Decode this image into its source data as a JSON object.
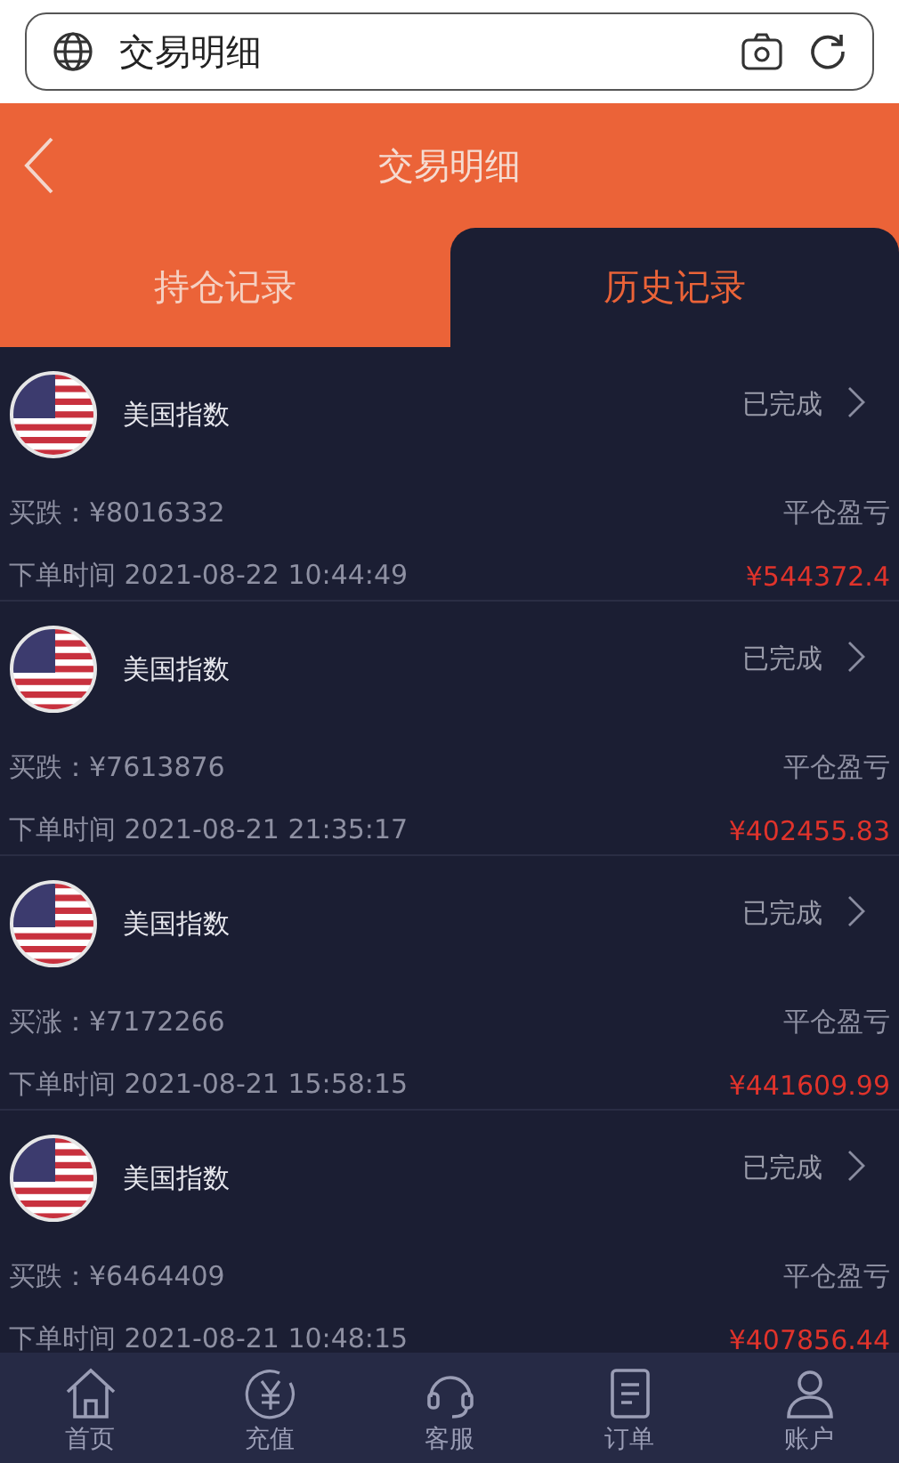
{
  "address_bar": {
    "title": "交易明细"
  },
  "header": {
    "title": "交易明细"
  },
  "tabs": [
    {
      "label": "持仓记录",
      "selected": false
    },
    {
      "label": "历史记录",
      "selected": true
    }
  ],
  "orders": [
    {
      "name": "美国指数",
      "status": "已完成",
      "trade": "买跌：¥8016332",
      "pnl_label": "平仓盈亏",
      "time": "下单时间 2021-08-22 10:44:49",
      "pnl": "¥544372.4"
    },
    {
      "name": "美国指数",
      "status": "已完成",
      "trade": "买跌：¥7613876",
      "pnl_label": "平仓盈亏",
      "time": "下单时间 2021-08-21 21:35:17",
      "pnl": "¥402455.83"
    },
    {
      "name": "美国指数",
      "status": "已完成",
      "trade": "买涨：¥7172266",
      "pnl_label": "平仓盈亏",
      "time": "下单时间 2021-08-21 15:58:15",
      "pnl": "¥441609.99"
    },
    {
      "name": "美国指数",
      "status": "已完成",
      "trade": "买跌：¥6464409",
      "pnl_label": "平仓盈亏",
      "time": "下单时间 2021-08-21 10:48:15",
      "pnl": "¥407856.44"
    }
  ],
  "nav": [
    {
      "label": "首页",
      "kind": "home"
    },
    {
      "label": "充值",
      "kind": "recharge"
    },
    {
      "label": "客服",
      "kind": "support"
    },
    {
      "label": "订单",
      "kind": "orders"
    },
    {
      "label": "账户",
      "kind": "account"
    }
  ]
}
